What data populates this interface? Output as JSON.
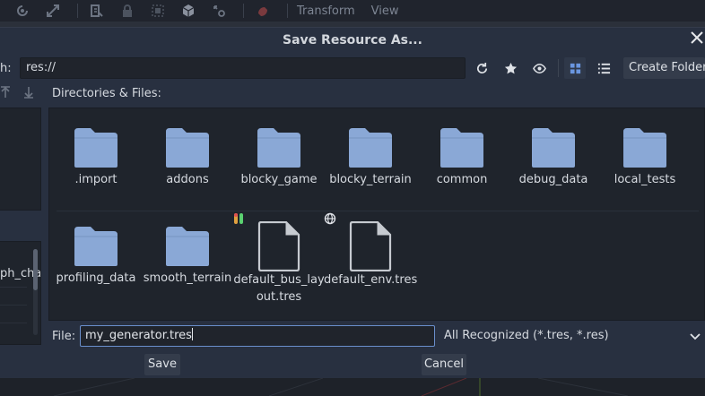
{
  "toolbar": {
    "icons": [
      "rotate-icon",
      "scale-icon",
      "list-select-icon",
      "lock-icon",
      "group-icon",
      "cube-icon",
      "pivot-icon",
      "tool-icon"
    ],
    "menus": [
      "Transform",
      "View"
    ]
  },
  "dialog": {
    "title": "Save Resource As...",
    "path_label": "h:",
    "path_value": "res://",
    "create_folder_label": "Create Folder",
    "dirs_files_label": "Directories & Files:",
    "left_panel_text": "ph_char",
    "files": [
      {
        "name": ".import",
        "type": "folder"
      },
      {
        "name": "addons",
        "type": "folder"
      },
      {
        "name": "blocky_game",
        "type": "folder"
      },
      {
        "name": "blocky_terrain",
        "type": "folder"
      },
      {
        "name": "common",
        "type": "folder"
      },
      {
        "name": "debug_data",
        "type": "folder"
      },
      {
        "name": "local_tests",
        "type": "folder"
      },
      {
        "name": "profiling_data",
        "type": "folder"
      },
      {
        "name": "smooth_terrain",
        "type": "folder"
      },
      {
        "name": "default_bus_layout.tres",
        "name_line1": "default_bus_lay",
        "name_line2": "out.tres",
        "type": "file",
        "badge": "audio-bus-icon"
      },
      {
        "name": "default_env.tres",
        "type": "file",
        "badge": "environment-globe-icon"
      }
    ],
    "file_label": "File:",
    "file_value": "my_generator.tres",
    "filter_value": "All Recognized (*.tres, *.res)",
    "save_label": "Save",
    "cancel_label": "Cancel"
  },
  "colors": {
    "folder": "#8aa8d6",
    "file": "#c6cad0",
    "accent": "#6a8fcc",
    "dialog_bg": "#283040",
    "panel_bg": "#1f242c"
  }
}
